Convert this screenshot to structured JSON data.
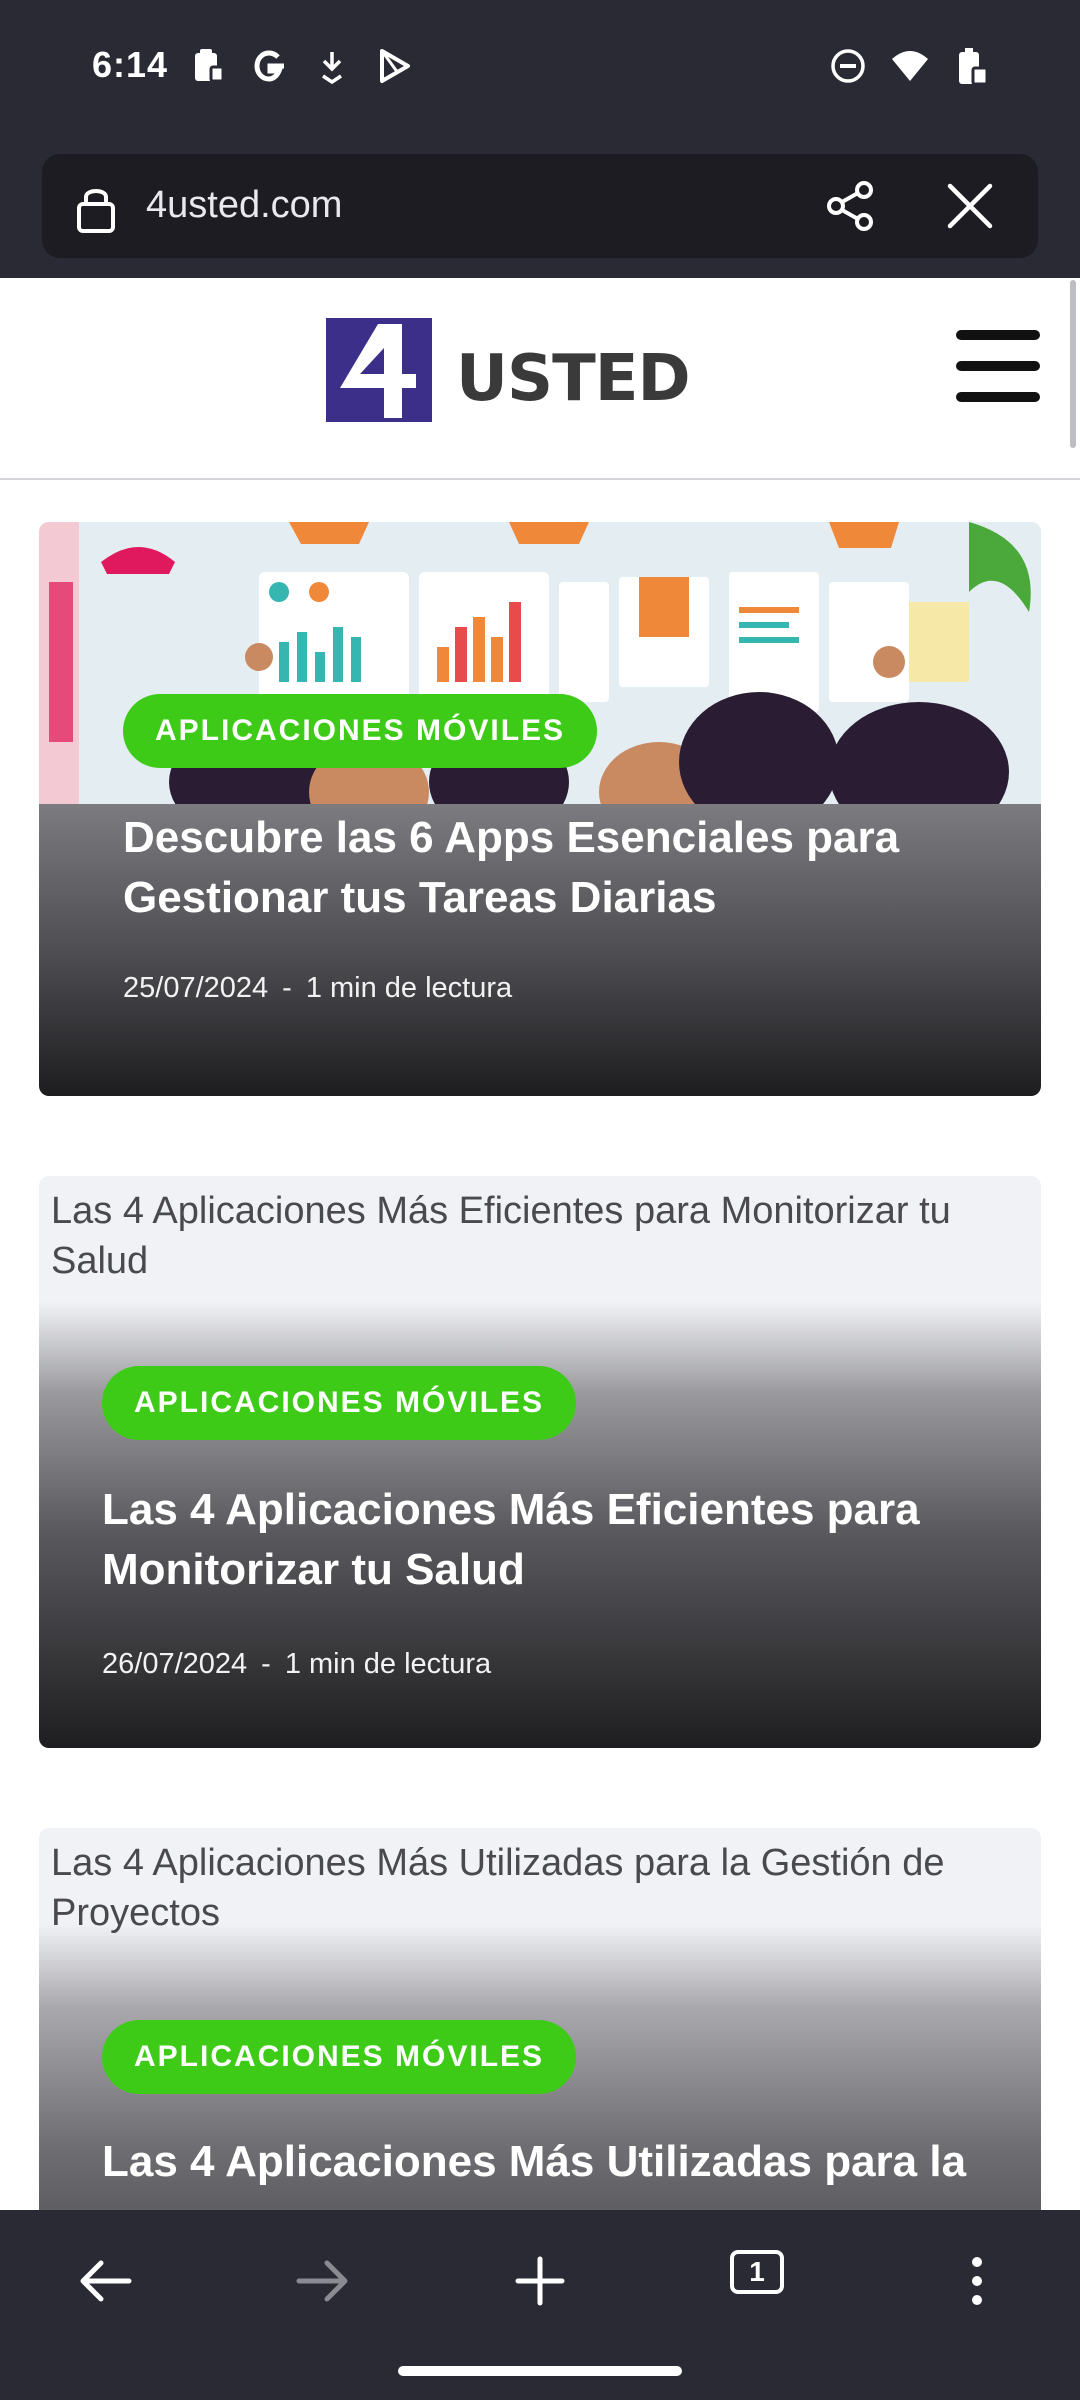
{
  "status_bar": {
    "time": "6:14",
    "left_icons": [
      "clipboard-icon",
      "google-g-icon",
      "download-icon",
      "play-store-icon"
    ],
    "right_icons": [
      "do-not-disturb-icon",
      "wifi-icon",
      "battery-icon"
    ]
  },
  "browser": {
    "url": "4usted.com",
    "icons": [
      "lock-icon",
      "share-icon",
      "close-icon"
    ]
  },
  "site": {
    "logo_number": "4",
    "logo_text": "USTED",
    "brand_color": "#3b2f8a"
  },
  "articles": [
    {
      "category": "APLICACIONES MÓVILES",
      "title": "Descubre las 6 Apps Esenciales para Gestionar tus Tareas Diarias",
      "date": "25/07/2024",
      "separator": "-",
      "read_time": "1 min de lectura"
    },
    {
      "image_alt": "Las 4 Aplicaciones Más Eficientes para Monitorizar tu Salud",
      "category": "APLICACIONES MÓVILES",
      "title": "Las 4 Aplicaciones Más Eficientes para Monitorizar tu Salud",
      "date": "26/07/2024",
      "separator": "-",
      "read_time": "1 min de lectura"
    },
    {
      "image_alt": "Las 4 Aplicaciones Más Utilizadas para la Gestión de Proyectos",
      "category": "APLICACIONES MÓVILES",
      "title": "Las 4 Aplicaciones Más Utilizadas para la"
    }
  ],
  "toolbar": {
    "tab_count": "1",
    "icons": [
      "back-arrow-icon",
      "forward-arrow-icon",
      "new-tab-icon",
      "tabs-icon",
      "more-options-icon"
    ]
  },
  "colors": {
    "system_bar": "#2a2a34",
    "badge_green": "#3ecb18"
  }
}
